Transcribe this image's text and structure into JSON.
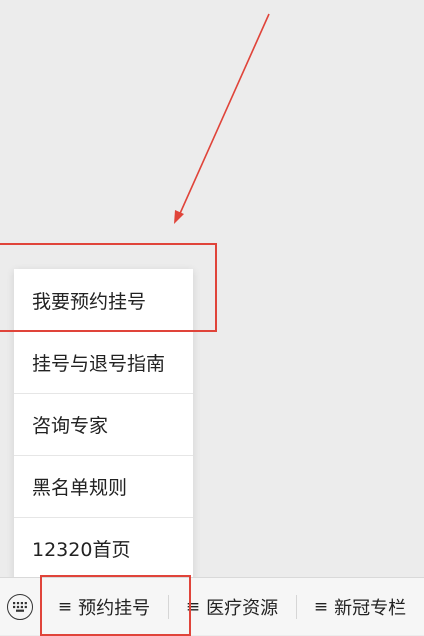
{
  "submenu": {
    "items": [
      {
        "label": "我要预约挂号"
      },
      {
        "label": "挂号与退号指南"
      },
      {
        "label": "咨询专家"
      },
      {
        "label": "黑名单规则"
      },
      {
        "label": "12320首页"
      }
    ]
  },
  "menu_bar": {
    "keyboard_icon": "keyboard-icon",
    "tabs": [
      {
        "icon": "≡",
        "label": "预约挂号"
      },
      {
        "icon": "≡",
        "label": "医疗资源"
      },
      {
        "icon": "≡",
        "label": "新冠专栏"
      }
    ]
  },
  "annotation": {
    "color": "#e0443a"
  }
}
